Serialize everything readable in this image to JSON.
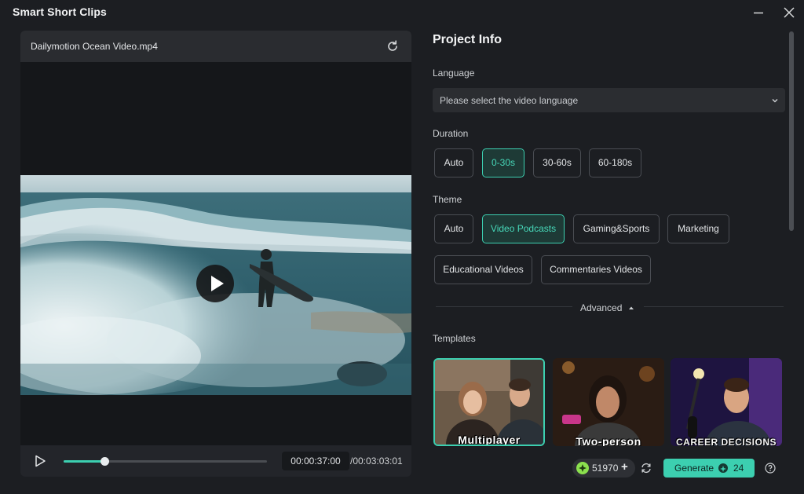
{
  "app": {
    "title": "Smart Short Clips"
  },
  "player": {
    "file_name": "Dailymotion Ocean Video.mp4",
    "current_time": "00:00:37:00",
    "total_time": "/00:03:03:01",
    "progress": 0.2
  },
  "project": {
    "title": "Project Info",
    "language_label": "Language",
    "language_placeholder": "Please select the video language",
    "duration_label": "Duration",
    "durations": [
      "Auto",
      "0-30s",
      "30-60s",
      "60-180s"
    ],
    "selected_duration": "0-30s",
    "theme_label": "Theme",
    "themes": [
      "Auto",
      "Video Podcasts",
      "Gaming&Sports",
      "Marketing",
      "Educational Videos",
      "Commentaries Videos"
    ],
    "selected_theme": "Video Podcasts",
    "advanced_label": "Advanced",
    "templates_label": "Templates",
    "templates": [
      "Multiplayer",
      "Two-person",
      "CAREER DECISIONS"
    ]
  },
  "footer": {
    "credits": "51970",
    "generate_label": "Generate",
    "generate_cost": "24"
  },
  "colors": {
    "accent": "#3ccfb0",
    "background": "#1c1e22",
    "panel": "#2b2d31"
  }
}
